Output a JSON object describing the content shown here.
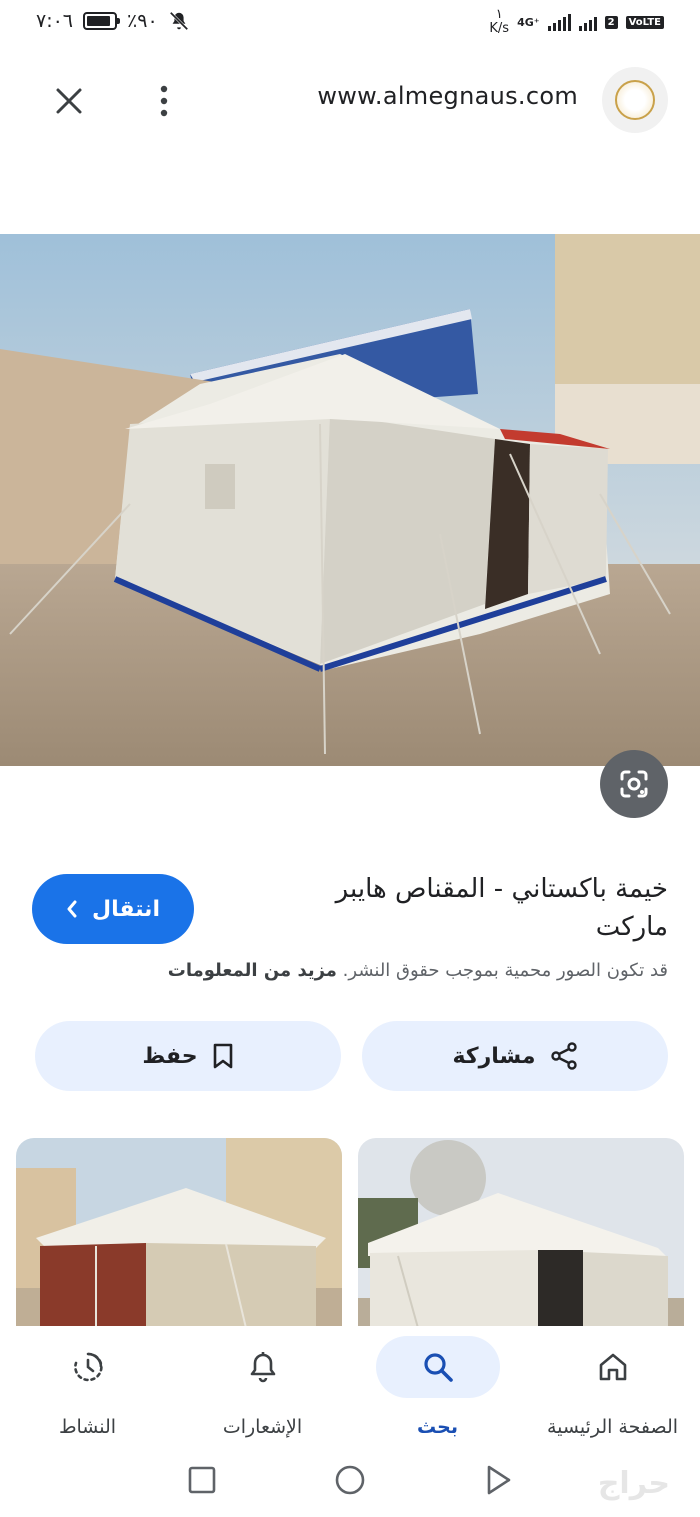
{
  "status_bar": {
    "time": "٧:٠٦",
    "battery": "٪٩٠",
    "battery_level_percent": 90,
    "speed_value": "١",
    "speed_unit": "K/s",
    "network": "4G⁺",
    "sim_badge": "VoLTE",
    "sim_slot": "2"
  },
  "browser": {
    "url": "www.almegnaus.com"
  },
  "result": {
    "title": "خيمة باكستاني - المقناص هايبر ماركت",
    "visit_label": "انتقال",
    "copyright_text": "قد تكون الصور محمية بموجب حقوق النشر.",
    "more_info": "مزيد من المعلومات",
    "save_label": "حفظ",
    "share_label": "مشاركة"
  },
  "bottom_nav": {
    "items": [
      {
        "label": "الصفحة الرئيسية",
        "icon": "home-icon"
      },
      {
        "label": "بحث",
        "icon": "search-icon",
        "active": true
      },
      {
        "label": "الإشعارات",
        "icon": "bell-icon"
      },
      {
        "label": "النشاط",
        "icon": "activity-icon"
      }
    ]
  },
  "watermark": "حراج",
  "colors": {
    "accent": "#1a73e8",
    "tonal": "#e8f0fe",
    "lens": "#5f6368"
  }
}
